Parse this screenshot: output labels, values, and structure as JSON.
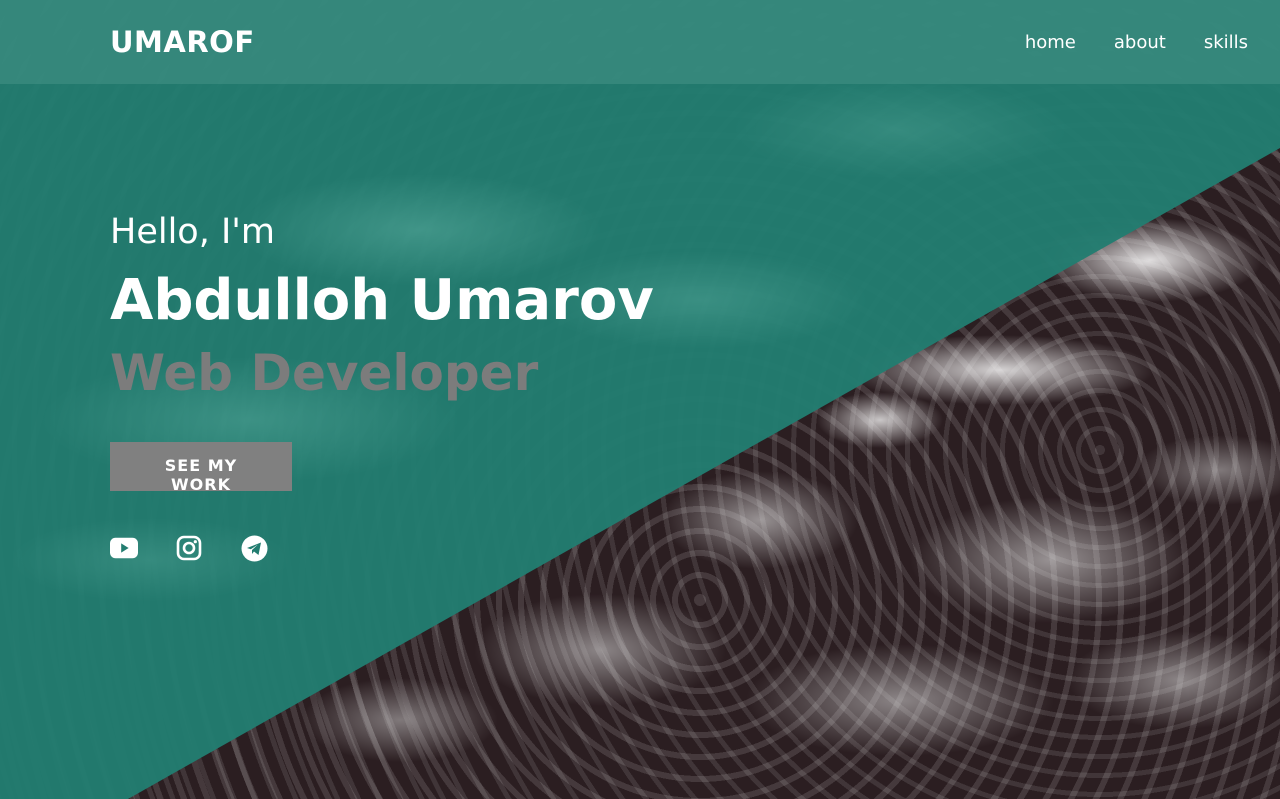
{
  "brand": {
    "logo": "UMAROF"
  },
  "nav": {
    "items": [
      {
        "label": "home"
      },
      {
        "label": "about"
      },
      {
        "label": "skills"
      }
    ]
  },
  "hero": {
    "greeting": "Hello, I'm",
    "name": "Abdulloh Umarov",
    "role": "Web Developer",
    "cta_label": "SEE MY WORK"
  },
  "socials": {
    "items": [
      {
        "icon": "youtube-icon"
      },
      {
        "icon": "instagram-icon"
      },
      {
        "icon": "telegram-icon"
      }
    ]
  },
  "colors": {
    "overlay": "#227d70",
    "nav_bar": "#3c8c80",
    "role_text": "#7c7c7c",
    "cta_bg": "#808080",
    "text": "#ffffff"
  }
}
